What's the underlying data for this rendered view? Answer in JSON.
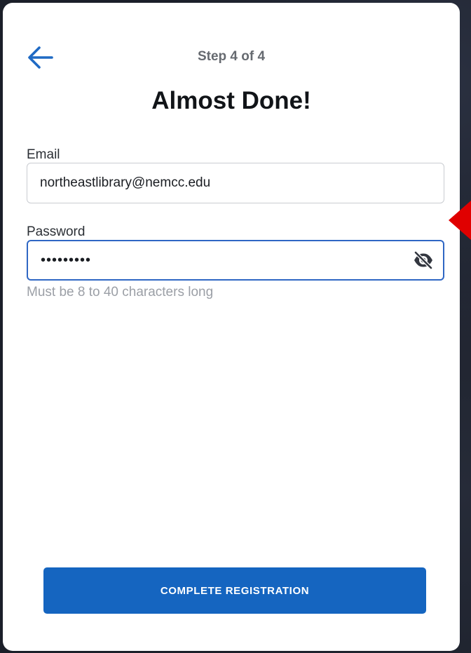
{
  "header": {
    "step_label": "Step 4 of 4",
    "title": "Almost Done!",
    "back_icon": "arrow-left-icon"
  },
  "form": {
    "email": {
      "label": "Email",
      "value": "northeastlibrary@nemcc.edu",
      "placeholder": ""
    },
    "password": {
      "label": "Password",
      "value": "•••••••••",
      "placeholder": "",
      "toggle_icon": "eye-off-icon",
      "hint": "Must be 8 to 40 characters long"
    },
    "submit_label": "COMPLETE REGISTRATION"
  },
  "colors": {
    "accent": "#1565c0",
    "focus_border": "#2f67c4",
    "pointer": "#e00000"
  }
}
